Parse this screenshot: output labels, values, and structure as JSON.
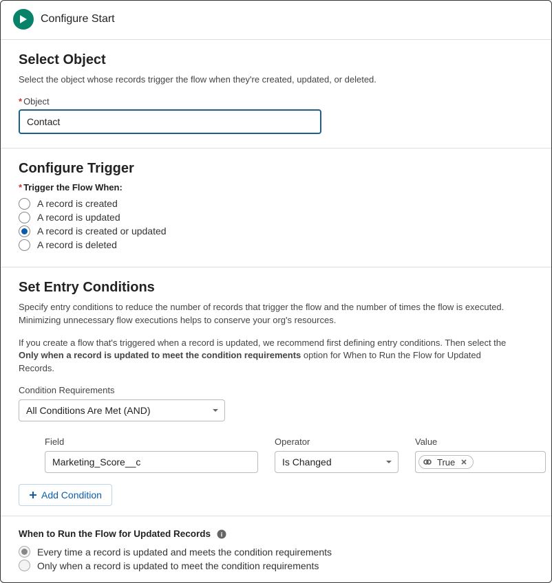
{
  "header": {
    "title": "Configure Start"
  },
  "selectObject": {
    "title": "Select Object",
    "help": "Select the object whose records trigger the flow when they're created, updated, or deleted.",
    "objectLabel": "Object",
    "objectValue": "Contact"
  },
  "configureTrigger": {
    "title": "Configure Trigger",
    "label": "Trigger the Flow When:",
    "options": [
      {
        "label": "A record is created",
        "selected": false
      },
      {
        "label": "A record is updated",
        "selected": false
      },
      {
        "label": "A record is created or updated",
        "selected": true
      },
      {
        "label": "A record is deleted",
        "selected": false
      }
    ]
  },
  "entryConditions": {
    "title": "Set Entry Conditions",
    "help1": "Specify entry conditions to reduce the number of records that trigger the flow and the number of times the flow is executed. Minimizing unnecessary flow executions helps to conserve your org's resources.",
    "help2_prefix": "If you create a flow that's triggered when a record is updated, we recommend first defining entry conditions. Then select the ",
    "help2_bold": "Only when a record is updated to meet the condition requirements",
    "help2_suffix": " option for When to Run the Flow for Updated Records.",
    "condReqLabel": "Condition Requirements",
    "condReqValue": "All Conditions Are Met (AND)",
    "columns": {
      "field": "Field",
      "operator": "Operator",
      "value": "Value"
    },
    "row": {
      "field": "Marketing_Score__c",
      "operator": "Is Changed",
      "value": "True"
    },
    "addCondition": "Add Condition"
  },
  "whenRun": {
    "title": "When to Run the Flow for Updated Records",
    "options": [
      {
        "label": "Every time a record is updated and meets the condition requirements",
        "selected": true
      },
      {
        "label": "Only when a record is updated to meet the condition requirements",
        "selected": false
      }
    ]
  }
}
